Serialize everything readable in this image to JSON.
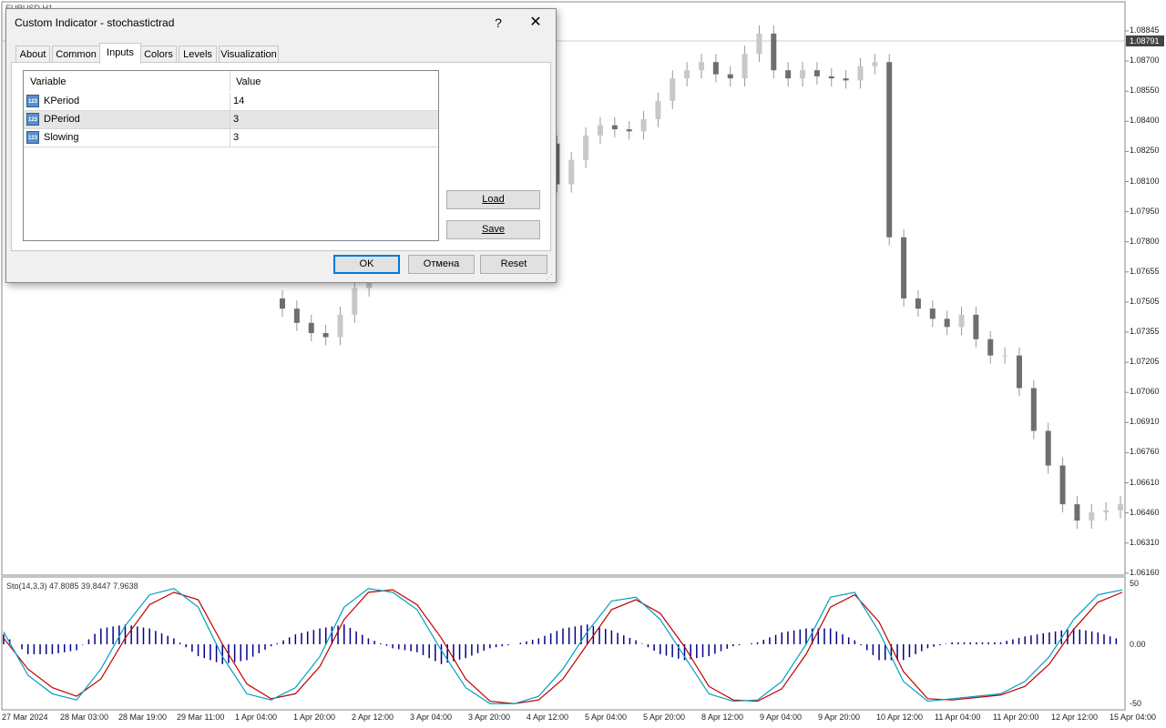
{
  "chart_header": {
    "symbol": "EURUSD,H1"
  },
  "price_axis": {
    "labels": [
      "1.08845",
      "1.08700",
      "1.08550",
      "1.08400",
      "1.08250",
      "1.08100",
      "1.07950",
      "1.07800",
      "1.07655",
      "1.07505",
      "1.07355",
      "1.07205",
      "1.07060",
      "1.06910",
      "1.06760",
      "1.06610",
      "1.06460",
      "1.06310",
      "1.06160"
    ],
    "current_price": "1.08791"
  },
  "time_axis": {
    "labels": [
      "27 Mar 2024",
      "28 Mar 03:00",
      "28 Mar 19:00",
      "29 Mar 11:00",
      "1 Apr 04:00",
      "1 Apr 20:00",
      "2 Apr 12:00",
      "3 Apr 04:00",
      "3 Apr 20:00",
      "4 Apr 12:00",
      "5 Apr 04:00",
      "5 Apr 20:00",
      "8 Apr 12:00",
      "9 Apr 04:00",
      "9 Apr 20:00",
      "10 Apr 12:00",
      "11 Apr 04:00",
      "11 Apr 20:00",
      "12 Apr 12:00",
      "15 Apr 04:00"
    ]
  },
  "indicator": {
    "label": "Sto(14,3,3) 47.8085 39.8447 7.9638",
    "scale": [
      "50",
      "0.00",
      "-50"
    ],
    "main_color": "#00a0c0",
    "signal_color": "#c00000",
    "histogram_color": "#00008b"
  },
  "chart_data": [
    {
      "type": "candlestick",
      "title": "",
      "ylim": [
        1.0616,
        1.0892
      ],
      "close_approx": [
        1.0745,
        1.0738,
        1.0733,
        1.0731,
        1.0742,
        1.0755,
        1.0768,
        1.0775,
        1.079,
        1.0806,
        1.0824,
        1.0845,
        1.0852,
        1.084,
        1.083,
        1.0828,
        1.0835,
        1.084,
        1.0826,
        1.0806,
        1.0818,
        1.083,
        1.0835,
        1.0833,
        1.0832,
        1.0838,
        1.0847,
        1.0858,
        1.0862,
        1.0866,
        1.086,
        1.0858,
        1.087,
        1.088,
        1.0862,
        1.0858,
        1.0862,
        1.0859,
        1.0858,
        1.0857,
        1.0864,
        1.0866,
        1.078,
        1.075,
        1.0745,
        1.074,
        1.0736,
        1.0742,
        1.073,
        1.0722,
        1.0722,
        1.0706,
        1.0685,
        1.0668,
        1.0649,
        1.0641,
        1.0645,
        1.0646,
        1.0649
      ]
    },
    {
      "type": "line",
      "title": "",
      "ylim": [
        -50,
        50
      ],
      "series": [
        {
          "values": [
            10,
            -25,
            -40,
            -45,
            -20,
            15,
            40,
            45,
            30,
            -10,
            -40,
            -45,
            -35,
            -10,
            30,
            45,
            42,
            28,
            -5,
            -35,
            -48,
            -48,
            -42,
            -20,
            10,
            35,
            38,
            20,
            -10,
            -40,
            -46,
            -45,
            -30,
            0,
            38,
            42,
            10,
            -30,
            -46,
            -44,
            -42,
            -40,
            -30,
            -10,
            20,
            40,
            44
          ]
        },
        {
          "values": [
            5,
            -20,
            -35,
            -42,
            -28,
            5,
            32,
            42,
            36,
            0,
            -32,
            -44,
            -40,
            -18,
            20,
            42,
            44,
            32,
            5,
            -28,
            -46,
            -48,
            -45,
            -28,
            0,
            28,
            36,
            25,
            -2,
            -34,
            -45,
            -46,
            -36,
            -8,
            30,
            40,
            18,
            -22,
            -44,
            -45,
            -43,
            -41,
            -34,
            -16,
            12,
            34,
            42
          ]
        }
      ]
    }
  ],
  "dialog": {
    "title": "Custom Indicator - stochastictrad",
    "help": "?",
    "close": "✕",
    "tabs": [
      "About",
      "Common",
      "Inputs",
      "Colors",
      "Levels",
      "Visualization"
    ],
    "active_tab": "Inputs",
    "grid": {
      "headers": {
        "variable": "Variable",
        "value": "Value"
      },
      "rows": [
        {
          "icon_text": "123",
          "variable": "KPeriod",
          "value": "14"
        },
        {
          "icon_text": "123",
          "variable": "DPeriod",
          "value": "3"
        },
        {
          "icon_text": "123",
          "variable": "Slowing",
          "value": "3"
        }
      ]
    },
    "buttons": {
      "load": "Load",
      "save": "Save",
      "ok": "OK",
      "cancel": "Отмена",
      "reset": "Reset"
    }
  }
}
